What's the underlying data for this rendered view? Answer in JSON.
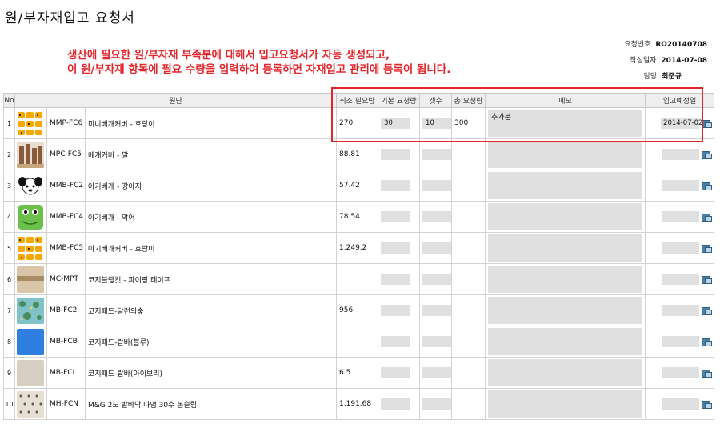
{
  "page_title": "원/부자재입고 요청서",
  "meta": {
    "request_no_label": "요청번호",
    "request_no": "RO20140708",
    "date_label": "작성일자",
    "date": "2014-07-08",
    "manager_label": "담당",
    "manager": "최준규"
  },
  "annotation": {
    "line1": "생산에 필요한 원/부자재 부족분에 대해서 입고요청서가 자동 생성되고,",
    "line2": "이 원/부자재 항목에 필요 수량을 입력하여 등록하면 자재입고 관리에 등록이 됩니다."
  },
  "columns": {
    "no": "No",
    "fabric": "원단",
    "min_required": "최소 필요량",
    "base_qty": "기본 요청량",
    "count": "갯수",
    "total": "총 요청량",
    "memo": "메모",
    "expected_date": "입고예정일"
  },
  "rows": [
    {
      "no": "1",
      "code": "MMP-FC6",
      "name": "미니베개커버 - 호랑이",
      "min_required": "270",
      "base_qty": "30",
      "count": "10",
      "total": "300",
      "memo": "추가분",
      "expected_date": "2014-07-02",
      "thumb": "tiger-pattern"
    },
    {
      "no": "2",
      "code": "MPC-FC5",
      "name": "베개커버 - 말",
      "min_required": "88.81",
      "base_qty": "",
      "count": "",
      "total": "",
      "memo": "",
      "expected_date": "",
      "thumb": "horse-pattern"
    },
    {
      "no": "3",
      "code": "MMB-FC2",
      "name": "아기베개 - 강아지",
      "min_required": "57.42",
      "base_qty": "",
      "count": "",
      "total": "",
      "memo": "",
      "expected_date": "",
      "thumb": "puppy-pattern"
    },
    {
      "no": "4",
      "code": "MMB-FC4",
      "name": "아기베개 - 악어",
      "min_required": "78.54",
      "base_qty": "",
      "count": "",
      "total": "",
      "memo": "",
      "expected_date": "",
      "thumb": "crocodile-pattern"
    },
    {
      "no": "5",
      "code": "MMB-FC5",
      "name": "아기베개커버 - 호랑이",
      "min_required": "1,249.2",
      "base_qty": "",
      "count": "",
      "total": "",
      "memo": "",
      "expected_date": "",
      "thumb": "tiger-pattern"
    },
    {
      "no": "6",
      "code": "MC-MPT",
      "name": "코지블랭킷 - 파이핑 테이프",
      "min_required": "",
      "base_qty": "",
      "count": "",
      "total": "",
      "memo": "",
      "expected_date": "",
      "thumb": "tape-pattern"
    },
    {
      "no": "7",
      "code": "MB-FC2",
      "name": "코지패드-달런의숲",
      "min_required": "956",
      "base_qty": "",
      "count": "",
      "total": "",
      "memo": "",
      "expected_date": "",
      "thumb": "forest-pattern"
    },
    {
      "no": "8",
      "code": "MB-FCB",
      "name": "코지패드-랍바(블루)",
      "min_required": "",
      "base_qty": "",
      "count": "",
      "total": "",
      "memo": "",
      "expected_date": "",
      "thumb": "blue-fabric"
    },
    {
      "no": "9",
      "code": "MB-FCI",
      "name": "코지패드-랍바(아이보리)",
      "min_required": "6.5",
      "base_qty": "",
      "count": "",
      "total": "",
      "memo": "",
      "expected_date": "",
      "thumb": "ivory-fabric"
    },
    {
      "no": "10",
      "code": "MH-FCN",
      "name": "M&G 2도 발바닥 나염 30수 논슬립",
      "min_required": "1,191.68",
      "base_qty": "",
      "count": "",
      "total": "",
      "memo": "",
      "expected_date": "",
      "thumb": "footprint-fabric"
    }
  ],
  "colors": {
    "accent_red": "#e3262c",
    "input_gray": "#e0e0e0",
    "header_gray": "#eeeeee"
  }
}
